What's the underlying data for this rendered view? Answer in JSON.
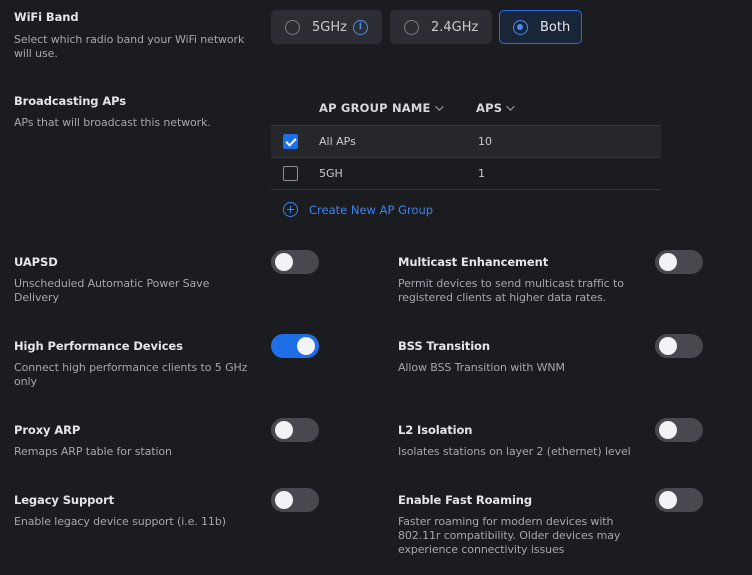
{
  "wifi_band": {
    "title": "WiFi Band",
    "description": "Select which radio band your WiFi network will use.",
    "options": [
      {
        "label": "5GHz",
        "selected": false,
        "has_info": true
      },
      {
        "label": "2.4GHz",
        "selected": false
      },
      {
        "label": "Both",
        "selected": true
      }
    ],
    "info_glyph": "i"
  },
  "broadcasting": {
    "title": "Broadcasting APs",
    "description": "APs that will broadcast this network.",
    "columns": {
      "name": "AP GROUP NAME",
      "aps": "APS"
    },
    "rows": [
      {
        "name": "All APs",
        "aps": "10",
        "checked": true
      },
      {
        "name": "5GH",
        "aps": "1",
        "checked": false
      }
    ],
    "create_label": "Create New AP Group"
  },
  "settings": [
    {
      "title": "UAPSD",
      "description": "Unscheduled Automatic Power Save Delivery",
      "enabled": false
    },
    {
      "title": "Multicast Enhancement",
      "description": "Permit devices to send multicast traffic to registered clients at higher data rates.",
      "enabled": false
    },
    {
      "title": "High Performance Devices",
      "description": "Connect high performance clients to 5 GHz only",
      "enabled": true
    },
    {
      "title": "BSS Transition",
      "description": "Allow BSS Transition with WNM",
      "enabled": false
    },
    {
      "title": "Proxy ARP",
      "description": "Remaps ARP table for station",
      "enabled": false
    },
    {
      "title": "L2 Isolation",
      "description": "Isolates stations on layer 2 (ethernet) level",
      "enabled": false
    },
    {
      "title": "Legacy Support",
      "description": "Enable legacy device support (i.e. 11b)",
      "enabled": false
    },
    {
      "title": "Enable Fast Roaming",
      "description": "Faster roaming for modern devices with 802.11r compatibility. Older devices may experience connectivity issues",
      "enabled": false
    }
  ],
  "colors": {
    "accent": "#1e6ee8",
    "background": "#1b1c1f",
    "toggle_off": "#47494f"
  }
}
